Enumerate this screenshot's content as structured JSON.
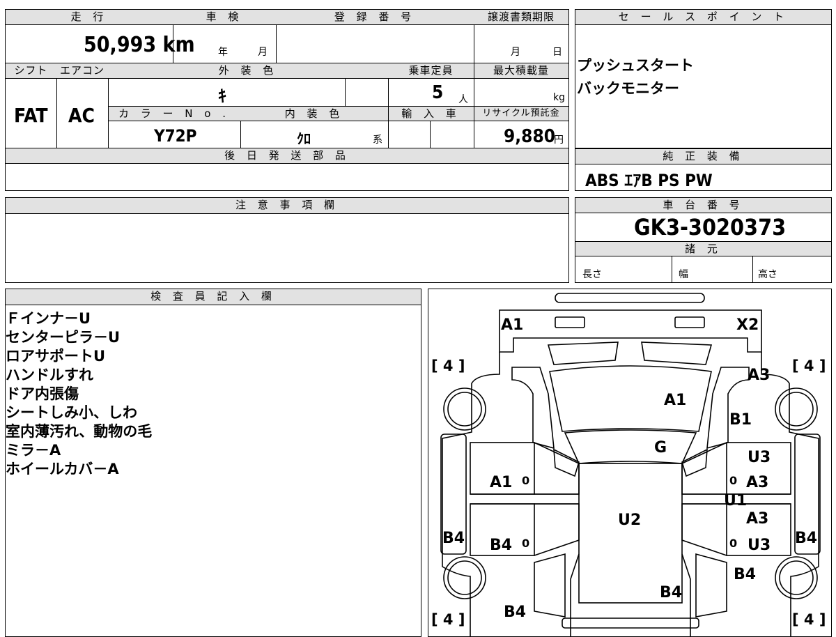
{
  "vehicle": {
    "headers": {
      "mileage": "走 行",
      "shaken": "車 検",
      "reg_no": "登 録 番 号",
      "transfer_deadline": "譲渡書類期限",
      "shift": "シフト",
      "aircon": "エアコン",
      "ext_color": "外 装 色",
      "capacity": "乗車定員",
      "max_load": "最大積載量",
      "color_no": "カ ラ ー N o .",
      "int_color": "内 装 色",
      "import": "輸 入 車",
      "recycle": "リサイクル預託金"
    },
    "mileage": "50,993 km",
    "shaken_year": "年",
    "shaken_month": "月",
    "deadline_month": "月",
    "deadline_day": "日",
    "shift": "FAT",
    "aircon": "AC",
    "ext_color": "ｷ",
    "capacity": "5",
    "capacity_unit": "人",
    "load_unit": "kg",
    "color_no": "Y72P",
    "int_color": "ｸﾛ",
    "int_color_suffix": "系",
    "recycle_fee": "9,880",
    "recycle_unit": "円"
  },
  "later_parts": {
    "title": "後 日 発 送 部 品"
  },
  "caution": {
    "title": "注 意 事 項 欄"
  },
  "sales_points": {
    "title": "セ ー ル ス ポ イ ン ト",
    "items": [
      "プッシュスタート",
      "バックモニター"
    ]
  },
  "equipment": {
    "title": "純 正 装 備",
    "value": "ABS ｴｱB PS PW"
  },
  "chassis": {
    "title": "車 台 番 号",
    "value": "GK3-3020373"
  },
  "specs": {
    "title": "諸 元",
    "length": "長さ",
    "width": "幅",
    "height": "高さ"
  },
  "inspector": {
    "title": "検 査 員 記 入 欄",
    "notes": [
      "Ｆインナ－U",
      "センターピラ－U",
      "ロアサポートU",
      "ハンドルすれ",
      "ドア内張傷",
      "シートしみ小、しわ",
      "室内薄汚れ、動物の毛",
      "ミラ－A",
      "ホイールカバ－A"
    ]
  },
  "diagram": {
    "tire_marks": [
      "[ 4 ]",
      "[ 4 ]",
      "[ 4 ]",
      "[ 4 ]"
    ],
    "labels": {
      "bumper_front_left": "A1",
      "bumper_front_right": "X2",
      "fender_right": "A3",
      "hood": "A1",
      "fender_right_lower": "B1",
      "windshield": "G",
      "door_right_front_top": "U3",
      "door_left_front": "A1",
      "door_right_front": "A3",
      "pillar_right": "U1",
      "roof": "U2",
      "door_right_rear_top": "A3",
      "door_left_rear": "B4",
      "door_right_rear": "U3",
      "rocker_left": "B4",
      "rocker_right": "B4",
      "quarter_right": "B4",
      "rear_center": "B4",
      "rear_left": "B4",
      "zero": "0"
    }
  }
}
